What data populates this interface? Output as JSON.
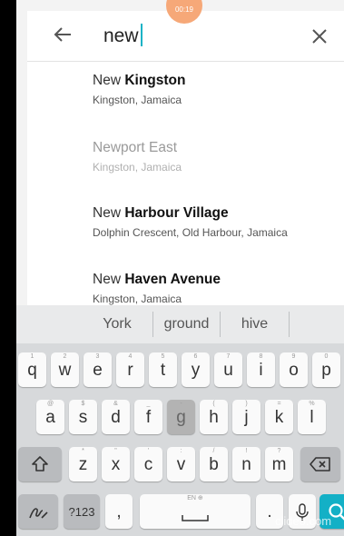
{
  "status": {
    "timer": "00:19"
  },
  "search": {
    "query": "new"
  },
  "results": [
    {
      "prefix": "New",
      "match": " Kingston",
      "subtitle": "Kingston, Jamaica",
      "faded": false
    },
    {
      "prefix": "Newport East",
      "match": "",
      "subtitle": "Kingston, Jamaica",
      "faded": true
    },
    {
      "prefix": "New",
      "match": " Harbour Village",
      "subtitle": "Dolphin Crescent, Old Harbour, Jamaica",
      "faded": false
    },
    {
      "prefix": "New",
      "match": " Haven Avenue",
      "subtitle": "Kingston, Jamaica",
      "faded": false
    }
  ],
  "keyboard": {
    "suggestions": [
      "York",
      "ground",
      "hive"
    ],
    "row1": [
      {
        "label": "q",
        "hint": "1"
      },
      {
        "label": "w",
        "hint": "2"
      },
      {
        "label": "e",
        "hint": "3"
      },
      {
        "label": "r",
        "hint": "4"
      },
      {
        "label": "t",
        "hint": "5"
      },
      {
        "label": "y",
        "hint": "6"
      },
      {
        "label": "u",
        "hint": "7"
      },
      {
        "label": "i",
        "hint": "8"
      },
      {
        "label": "o",
        "hint": "9"
      },
      {
        "label": "p",
        "hint": "0"
      }
    ],
    "row2": [
      {
        "label": "a",
        "hint": "@"
      },
      {
        "label": "s",
        "hint": "$"
      },
      {
        "label": "d",
        "hint": "&"
      },
      {
        "label": "f",
        "hint": "_"
      },
      {
        "label": "g",
        "hint": "-"
      },
      {
        "label": "h",
        "hint": "("
      },
      {
        "label": "j",
        "hint": ")"
      },
      {
        "label": "k",
        "hint": "="
      },
      {
        "label": "l",
        "hint": "%"
      }
    ],
    "row3": [
      {
        "label": "z",
        "hint": "*"
      },
      {
        "label": "x",
        "hint": "\""
      },
      {
        "label": "c",
        "hint": "'"
      },
      {
        "label": "v",
        "hint": ":"
      },
      {
        "label": "b",
        "hint": "/"
      },
      {
        "label": "n",
        "hint": "!"
      },
      {
        "label": "m",
        "hint": "?"
      }
    ],
    "symbols_label": "?123",
    "comma": ",",
    "space_hint": "EN ⊕",
    "period": "."
  },
  "watermark": "clideo.com",
  "colors": {
    "accent": "#13b0c6",
    "timer": "#f6a878"
  }
}
